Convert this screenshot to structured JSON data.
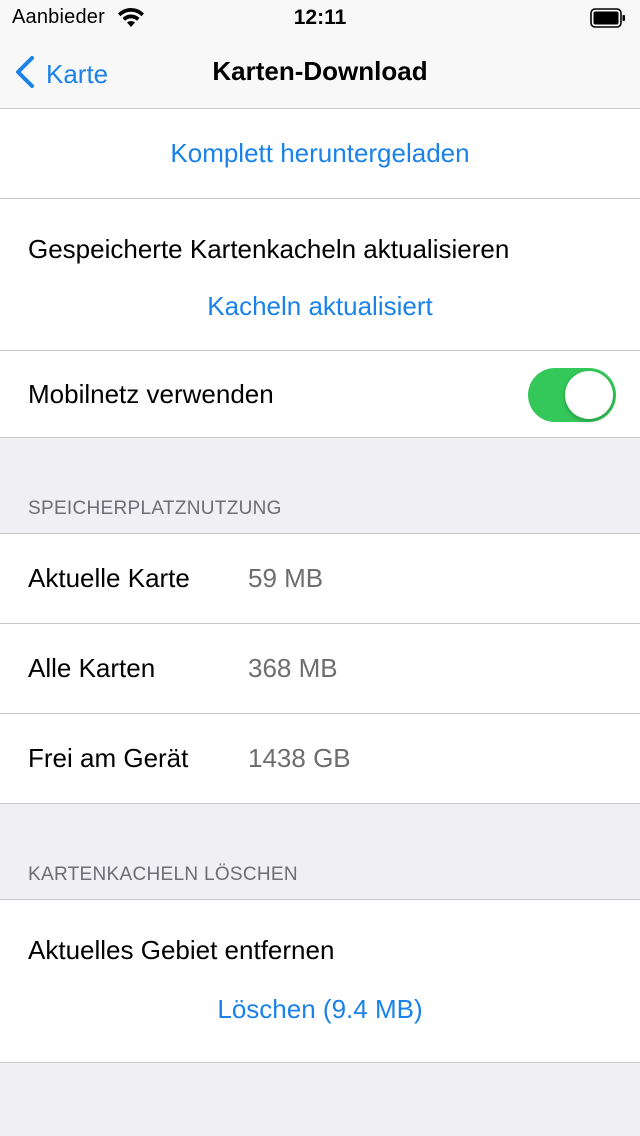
{
  "status_bar": {
    "carrier": "Aanbieder",
    "time": "12:11"
  },
  "nav": {
    "back_label": "Karte",
    "title": "Karten-Download"
  },
  "download": {
    "status_link": "Komplett heruntergeladen"
  },
  "update": {
    "label": "Gespeicherte Kartenkacheln aktualisieren",
    "status_link": "Kacheln aktualisiert"
  },
  "mobile_data": {
    "label": "Mobilnetz verwenden",
    "enabled": true
  },
  "storage": {
    "header": "SPEICHERPLATZNUTZUNG",
    "rows": [
      {
        "label": "Aktuelle Karte",
        "value": "59 MB"
      },
      {
        "label": "Alle Karten",
        "value": "368 MB"
      },
      {
        "label": "Frei am Gerät",
        "value": "1438 GB"
      }
    ]
  },
  "delete": {
    "header": "KARTENKACHELN LÖSCHEN",
    "label": "Aktuelles Gebiet entfernen",
    "button": "Löschen (9.4 MB)"
  },
  "colors": {
    "accent": "#1a82e8",
    "toggle_on": "#34c759",
    "background": "#efeff4",
    "secondary_text": "#6d6d72"
  }
}
